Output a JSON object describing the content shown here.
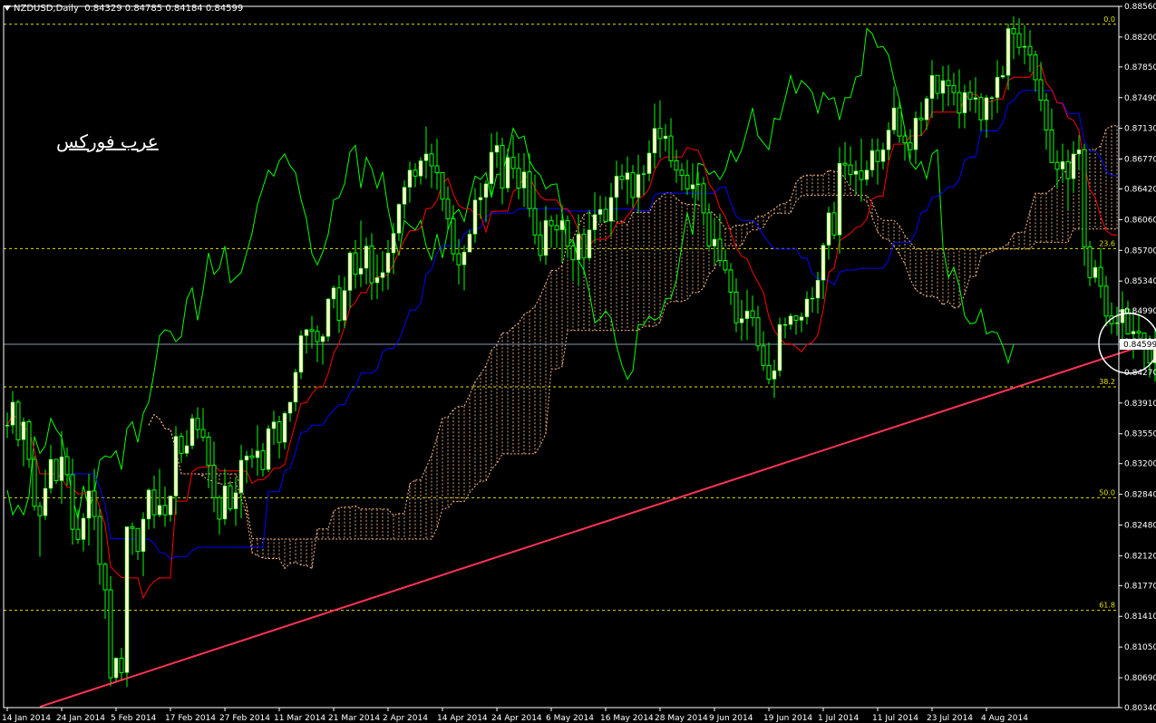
{
  "header": {
    "symbol": "NZDUSD,Daily",
    "ohlc": "0.84329 0.84785 0.84184 0.84599"
  },
  "watermark": "عرب فوركس",
  "colors": {
    "background": "#000000",
    "bull_candle": "#ffffcc",
    "candle_wick": "#00ff00",
    "chikou": "#00ff00",
    "tenkan": "#ff0000",
    "kijun": "#0000ff",
    "cloud": "#ffbb88",
    "fib_line": "#e0e000",
    "trendline": "#ff3355",
    "bid_line": "#8899aa",
    "axis_text": "#ffffff"
  },
  "chart_data": {
    "type": "candlestick",
    "title": "NZDUSD,Daily",
    "ylim": [
      0.8034,
      0.8856
    ],
    "y_ticks": [
      "0.88560",
      "0.88200",
      "0.87850",
      "0.87490",
      "0.87130",
      "0.86770",
      "0.86420",
      "0.86060",
      "0.85700",
      "0.85340",
      "0.84990",
      "0.84630",
      "0.84270",
      "0.83910",
      "0.83550",
      "0.83200",
      "0.82840",
      "0.82480",
      "0.82120",
      "0.81770",
      "0.81410",
      "0.81050",
      "0.80690",
      "0.80340"
    ],
    "x_ticks": [
      "14 Jan 2014",
      "24 Jan 2014",
      "5 Feb 2014",
      "17 Feb 2014",
      "27 Feb 2014",
      "11 Mar 2014",
      "21 Mar 2014",
      "2 Apr 2014",
      "14 Apr 2014",
      "24 Apr 2014",
      "6 May 2014",
      "16 May 2014",
      "28 May 2014",
      "9 Jun 2014",
      "19 Jun 2014",
      "1 Jul 2014",
      "11 Jul 2014",
      "23 Jul 2014",
      "4 Aug 2014"
    ],
    "current_price": "0.84599",
    "current_price_value": 0.84599,
    "fib_levels": [
      {
        "label": "0.0",
        "value": 0.8835
      },
      {
        "label": "23.6",
        "value": 0.8572
      },
      {
        "label": "38.2",
        "value": 0.841
      },
      {
        "label": "50.0",
        "value": 0.828
      },
      {
        "label": "61.8",
        "value": 0.8148
      }
    ],
    "trendline": {
      "start": {
        "bar": 6,
        "price": 0.8035
      },
      "end": {
        "bar": 212,
        "price": 0.8465
      }
    },
    "highlight_circle": {
      "bar": 205,
      "price": 0.8461
    },
    "candles_ohlc": [
      [
        0.8365,
        0.838,
        0.835,
        0.8365
      ],
      [
        0.8365,
        0.8405,
        0.8355,
        0.8392
      ],
      [
        0.8392,
        0.8395,
        0.834,
        0.8348
      ],
      [
        0.8348,
        0.8374,
        0.8317,
        0.8369
      ],
      [
        0.8369,
        0.8372,
        0.8315,
        0.8325
      ],
      [
        0.8325,
        0.8329,
        0.8265,
        0.827
      ],
      [
        0.827,
        0.8275,
        0.8211,
        0.8259
      ],
      [
        0.8259,
        0.8313,
        0.8254,
        0.8291
      ],
      [
        0.8291,
        0.8342,
        0.8285,
        0.8325
      ],
      [
        0.8325,
        0.8325,
        0.8296,
        0.83
      ],
      [
        0.83,
        0.8358,
        0.8273,
        0.8328
      ],
      [
        0.8328,
        0.8339,
        0.8294,
        0.8307
      ],
      [
        0.8307,
        0.8326,
        0.8225,
        0.8243
      ],
      [
        0.8243,
        0.8266,
        0.8226,
        0.8231
      ],
      [
        0.8231,
        0.8262,
        0.8217,
        0.8256
      ],
      [
        0.8256,
        0.8308,
        0.8224,
        0.8288
      ],
      [
        0.8288,
        0.8314,
        0.8242,
        0.8258
      ],
      [
        0.8258,
        0.8267,
        0.8178,
        0.8202
      ],
      [
        0.8202,
        0.8204,
        0.8138,
        0.8172
      ],
      [
        0.8172,
        0.8188,
        0.8059,
        0.8069
      ],
      [
        0.8069,
        0.8093,
        0.8063,
        0.8092
      ],
      [
        0.8092,
        0.8104,
        0.8066,
        0.8075
      ],
      [
        0.8075,
        0.8246,
        0.8058,
        0.8246
      ],
      [
        0.8246,
        0.8251,
        0.8213,
        0.8244
      ],
      [
        0.8244,
        0.8244,
        0.8207,
        0.8217
      ],
      [
        0.8217,
        0.8263,
        0.8188,
        0.8255
      ],
      [
        0.8255,
        0.8291,
        0.8243,
        0.8289
      ],
      [
        0.8289,
        0.8306,
        0.8244,
        0.826
      ],
      [
        0.826,
        0.8314,
        0.8257,
        0.8271
      ],
      [
        0.8271,
        0.8293,
        0.8246,
        0.826
      ],
      [
        0.826,
        0.8282,
        0.8252,
        0.8282
      ],
      [
        0.8282,
        0.8364,
        0.826,
        0.8352
      ],
      [
        0.8352,
        0.8356,
        0.8321,
        0.8332
      ],
      [
        0.8332,
        0.8359,
        0.8328,
        0.8341
      ],
      [
        0.8341,
        0.8378,
        0.8337,
        0.8373
      ],
      [
        0.8373,
        0.8386,
        0.8349,
        0.836
      ],
      [
        0.836,
        0.8385,
        0.8346,
        0.8351
      ],
      [
        0.8351,
        0.8357,
        0.8291,
        0.8318
      ],
      [
        0.8318,
        0.8346,
        0.8263,
        0.828
      ],
      [
        0.828,
        0.8283,
        0.8237,
        0.8255
      ],
      [
        0.8255,
        0.8314,
        0.8248,
        0.8294
      ],
      [
        0.8294,
        0.8299,
        0.8264,
        0.8267
      ],
      [
        0.8267,
        0.8304,
        0.8247,
        0.8286
      ],
      [
        0.8286,
        0.8342,
        0.8256,
        0.8324
      ],
      [
        0.8324,
        0.8335,
        0.8297,
        0.8329
      ],
      [
        0.8329,
        0.8338,
        0.8315,
        0.8327
      ],
      [
        0.8327,
        0.8365,
        0.8306,
        0.8335
      ],
      [
        0.8335,
        0.8344,
        0.8305,
        0.8313
      ],
      [
        0.8313,
        0.8365,
        0.831,
        0.8361
      ],
      [
        0.8361,
        0.8382,
        0.8342,
        0.8369
      ],
      [
        0.8369,
        0.8376,
        0.8326,
        0.8345
      ],
      [
        0.8345,
        0.8381,
        0.8337,
        0.8379
      ],
      [
        0.8379,
        0.8392,
        0.8369,
        0.8392
      ],
      [
        0.8392,
        0.8431,
        0.8381,
        0.8427
      ],
      [
        0.8427,
        0.8476,
        0.8419,
        0.847
      ],
      [
        0.847,
        0.8478,
        0.8449,
        0.8477
      ],
      [
        0.8477,
        0.8493,
        0.8455,
        0.8475
      ],
      [
        0.8475,
        0.8482,
        0.8439,
        0.8463
      ],
      [
        0.8463,
        0.8472,
        0.8436,
        0.8469
      ],
      [
        0.8469,
        0.8514,
        0.8463,
        0.8513
      ],
      [
        0.8513,
        0.8529,
        0.8502,
        0.8526
      ],
      [
        0.8526,
        0.8541,
        0.8473,
        0.8488
      ],
      [
        0.8488,
        0.8539,
        0.8479,
        0.8523
      ],
      [
        0.8523,
        0.8569,
        0.8502,
        0.8567
      ],
      [
        0.8567,
        0.8582,
        0.8525,
        0.8542
      ],
      [
        0.8542,
        0.8605,
        0.8527,
        0.8549
      ],
      [
        0.8549,
        0.8585,
        0.853,
        0.8575
      ],
      [
        0.8575,
        0.859,
        0.8512,
        0.8532
      ],
      [
        0.8532,
        0.8565,
        0.8513,
        0.8538
      ],
      [
        0.8538,
        0.8569,
        0.8522,
        0.8544
      ],
      [
        0.8544,
        0.8582,
        0.8524,
        0.8567
      ],
      [
        0.8567,
        0.8602,
        0.8542,
        0.859
      ],
      [
        0.859,
        0.8625,
        0.8581,
        0.8624
      ],
      [
        0.8624,
        0.8652,
        0.8607,
        0.8644
      ],
      [
        0.8644,
        0.8674,
        0.8626,
        0.8664
      ],
      [
        0.8664,
        0.8672,
        0.8644,
        0.8657
      ],
      [
        0.8657,
        0.8679,
        0.8647,
        0.8675
      ],
      [
        0.8675,
        0.8715,
        0.8654,
        0.8683
      ],
      [
        0.8683,
        0.8695,
        0.8643,
        0.8669
      ],
      [
        0.8669,
        0.8701,
        0.8641,
        0.8661
      ],
      [
        0.8661,
        0.866,
        0.8616,
        0.863
      ],
      [
        0.863,
        0.8645,
        0.8594,
        0.8607
      ],
      [
        0.8607,
        0.8623,
        0.8557,
        0.8566
      ],
      [
        0.8566,
        0.8583,
        0.853,
        0.8553
      ],
      [
        0.8553,
        0.8576,
        0.8523,
        0.8568
      ],
      [
        0.8568,
        0.8594,
        0.8568,
        0.8589
      ],
      [
        0.8589,
        0.8643,
        0.8579,
        0.8629
      ],
      [
        0.8629,
        0.8649,
        0.8607,
        0.8632
      ],
      [
        0.8632,
        0.8652,
        0.8603,
        0.8648
      ],
      [
        0.8648,
        0.8707,
        0.8632,
        0.8685
      ],
      [
        0.8685,
        0.8709,
        0.8667,
        0.8693
      ],
      [
        0.8693,
        0.8702,
        0.8624,
        0.8643
      ],
      [
        0.8643,
        0.8689,
        0.8638,
        0.8679
      ],
      [
        0.8679,
        0.8705,
        0.8654,
        0.8666
      ],
      [
        0.8666,
        0.8684,
        0.863,
        0.8643
      ],
      [
        0.8643,
        0.8684,
        0.8621,
        0.8662
      ],
      [
        0.8662,
        0.8684,
        0.8609,
        0.8619
      ],
      [
        0.8619,
        0.8659,
        0.8577,
        0.8588
      ],
      [
        0.8588,
        0.8604,
        0.8557,
        0.8564
      ],
      [
        0.8564,
        0.8622,
        0.8553,
        0.8605
      ],
      [
        0.8605,
        0.8611,
        0.8573,
        0.8599
      ],
      [
        0.8599,
        0.8612,
        0.8573,
        0.8594
      ],
      [
        0.8594,
        0.8623,
        0.8555,
        0.8605
      ],
      [
        0.8605,
        0.8611,
        0.8561,
        0.8575
      ],
      [
        0.8575,
        0.8581,
        0.8534,
        0.8559
      ],
      [
        0.8559,
        0.8612,
        0.8528,
        0.8589
      ],
      [
        0.8589,
        0.8596,
        0.8541,
        0.8561
      ],
      [
        0.8561,
        0.8617,
        0.8557,
        0.8594
      ],
      [
        0.8594,
        0.8638,
        0.8579,
        0.8612
      ],
      [
        0.8612,
        0.8634,
        0.8602,
        0.8618
      ],
      [
        0.8618,
        0.8633,
        0.8602,
        0.8604
      ],
      [
        0.8604,
        0.8649,
        0.8586,
        0.8632
      ],
      [
        0.8632,
        0.8675,
        0.8605,
        0.8657
      ],
      [
        0.8657,
        0.8671,
        0.8641,
        0.8653
      ],
      [
        0.8653,
        0.868,
        0.8624,
        0.8661
      ],
      [
        0.8661,
        0.867,
        0.862,
        0.8632
      ],
      [
        0.8632,
        0.8682,
        0.8613,
        0.8659
      ],
      [
        0.8659,
        0.867,
        0.8635,
        0.866
      ],
      [
        0.866,
        0.8699,
        0.8651,
        0.8684
      ],
      [
        0.8684,
        0.8742,
        0.8666,
        0.8713
      ],
      [
        0.8713,
        0.8746,
        0.8678,
        0.8701
      ],
      [
        0.8701,
        0.8718,
        0.8686,
        0.8704
      ],
      [
        0.8704,
        0.8725,
        0.8667,
        0.8675
      ],
      [
        0.8675,
        0.8688,
        0.8649,
        0.8664
      ],
      [
        0.8664,
        0.8672,
        0.864,
        0.8658
      ],
      [
        0.8658,
        0.8676,
        0.8635,
        0.8642
      ],
      [
        0.8642,
        0.8672,
        0.8631,
        0.8647
      ],
      [
        0.8647,
        0.8662,
        0.8628,
        0.8648
      ],
      [
        0.8648,
        0.8656,
        0.8599,
        0.8614
      ],
      [
        0.8614,
        0.8625,
        0.8571,
        0.8575
      ],
      [
        0.8575,
        0.8608,
        0.8553,
        0.8583
      ],
      [
        0.8583,
        0.8613,
        0.8551,
        0.8558
      ],
      [
        0.8558,
        0.8571,
        0.8543,
        0.8547
      ],
      [
        0.8547,
        0.8555,
        0.8506,
        0.8521
      ],
      [
        0.8521,
        0.8537,
        0.8474,
        0.8485
      ],
      [
        0.8485,
        0.8512,
        0.8464,
        0.849
      ],
      [
        0.849,
        0.8524,
        0.8465,
        0.8499
      ],
      [
        0.8499,
        0.8517,
        0.8481,
        0.8491
      ],
      [
        0.8491,
        0.8505,
        0.8452,
        0.8458
      ],
      [
        0.8458,
        0.8475,
        0.8429,
        0.8435
      ],
      [
        0.8435,
        0.8462,
        0.8413,
        0.8419
      ],
      [
        0.8419,
        0.8442,
        0.8397,
        0.8429
      ],
      [
        0.8429,
        0.8491,
        0.8422,
        0.8483
      ],
      [
        0.8483,
        0.8491,
        0.8467,
        0.8483
      ],
      [
        0.8483,
        0.8496,
        0.8477,
        0.8493
      ],
      [
        0.8493,
        0.8494,
        0.8471,
        0.8488
      ],
      [
        0.8488,
        0.8497,
        0.8474,
        0.8492
      ],
      [
        0.8492,
        0.8522,
        0.8483,
        0.8513
      ],
      [
        0.8513,
        0.8527,
        0.8497,
        0.8514
      ],
      [
        0.8514,
        0.8545,
        0.8496,
        0.8535
      ],
      [
        0.8535,
        0.8579,
        0.8513,
        0.8576
      ],
      [
        0.8576,
        0.8621,
        0.8559,
        0.8614
      ],
      [
        0.8614,
        0.8627,
        0.8583,
        0.8588
      ],
      [
        0.8588,
        0.8691,
        0.8566,
        0.8672
      ],
      [
        0.8672,
        0.8697,
        0.8653,
        0.867
      ],
      [
        0.867,
        0.8692,
        0.8646,
        0.8659
      ],
      [
        0.8659,
        0.8675,
        0.8635,
        0.8663
      ],
      [
        0.8663,
        0.8701,
        0.8627,
        0.8653
      ],
      [
        0.8653,
        0.8675,
        0.8646,
        0.8664
      ],
      [
        0.8664,
        0.8701,
        0.8656,
        0.8687
      ],
      [
        0.8687,
        0.8701,
        0.8647,
        0.8674
      ],
      [
        0.8674,
        0.8696,
        0.8665,
        0.8688
      ],
      [
        0.8688,
        0.872,
        0.8676,
        0.8711
      ],
      [
        0.8711,
        0.8762,
        0.8706,
        0.8737
      ],
      [
        0.8737,
        0.8746,
        0.8696,
        0.8704
      ],
      [
        0.8704,
        0.8711,
        0.8675,
        0.8696
      ],
      [
        0.8696,
        0.8712,
        0.8677,
        0.8688
      ],
      [
        0.8688,
        0.8733,
        0.8671,
        0.8725
      ],
      [
        0.8725,
        0.8744,
        0.8704,
        0.8723
      ],
      [
        0.8723,
        0.8751,
        0.8711,
        0.8748
      ],
      [
        0.8748,
        0.8793,
        0.8725,
        0.8775
      ],
      [
        0.8775,
        0.8775,
        0.8747,
        0.8754
      ],
      [
        0.8754,
        0.8786,
        0.8733,
        0.8769
      ],
      [
        0.8769,
        0.8787,
        0.8739,
        0.8763
      ],
      [
        0.8763,
        0.8778,
        0.874,
        0.8755
      ],
      [
        0.8755,
        0.8782,
        0.8713,
        0.8731
      ],
      [
        0.8731,
        0.8764,
        0.8713,
        0.8755
      ],
      [
        0.8755,
        0.8769,
        0.8733,
        0.8747
      ],
      [
        0.8747,
        0.8773,
        0.8731,
        0.8749
      ],
      [
        0.8749,
        0.8754,
        0.871,
        0.8723
      ],
      [
        0.8723,
        0.8752,
        0.8702,
        0.8749
      ],
      [
        0.8749,
        0.8751,
        0.8723,
        0.8749
      ],
      [
        0.8749,
        0.8793,
        0.8731,
        0.8773
      ],
      [
        0.8773,
        0.8786,
        0.8771,
        0.8775
      ],
      [
        0.8775,
        0.8836,
        0.8758,
        0.883
      ],
      [
        0.883,
        0.8844,
        0.8794,
        0.8824
      ],
      [
        0.8824,
        0.8842,
        0.8799,
        0.8808
      ],
      [
        0.8808,
        0.8834,
        0.8788,
        0.8809
      ],
      [
        0.8809,
        0.8828,
        0.8779,
        0.8799
      ],
      [
        0.8799,
        0.8804,
        0.8756,
        0.877
      ],
      [
        0.877,
        0.8791,
        0.8733,
        0.8746
      ],
      [
        0.8746,
        0.8754,
        0.8688,
        0.8711
      ],
      [
        0.8711,
        0.8736,
        0.8673,
        0.8673
      ],
      [
        0.8673,
        0.8687,
        0.8642,
        0.8665
      ],
      [
        0.8665,
        0.8695,
        0.8649,
        0.8674
      ],
      [
        0.8674,
        0.8688,
        0.8617,
        0.8654
      ],
      [
        0.8654,
        0.8698,
        0.8638,
        0.8683
      ],
      [
        0.8683,
        0.8705,
        0.8665,
        0.8688
      ],
      [
        0.8688,
        0.8695,
        0.8552,
        0.8574
      ],
      [
        0.8574,
        0.8581,
        0.8528,
        0.8538
      ],
      [
        0.8538,
        0.8559,
        0.8532,
        0.855
      ],
      [
        0.855,
        0.8573,
        0.8514,
        0.8528
      ],
      [
        0.8528,
        0.854,
        0.8481,
        0.8493
      ],
      [
        0.8493,
        0.8509,
        0.8472,
        0.8484
      ],
      [
        0.8484,
        0.8504,
        0.847,
        0.8485
      ],
      [
        0.8485,
        0.8522,
        0.846,
        0.8501
      ],
      [
        0.8501,
        0.8511,
        0.8471,
        0.8472
      ],
      [
        0.8472,
        0.8502,
        0.8443,
        0.8475
      ],
      [
        0.8475,
        0.8496,
        0.8459,
        0.8473
      ],
      [
        0.8473,
        0.8474,
        0.8432,
        0.8458
      ],
      [
        0.8458,
        0.847,
        0.8421,
        0.8438
      ],
      [
        0.8438,
        0.8477,
        0.8416,
        0.846
      ]
    ]
  }
}
